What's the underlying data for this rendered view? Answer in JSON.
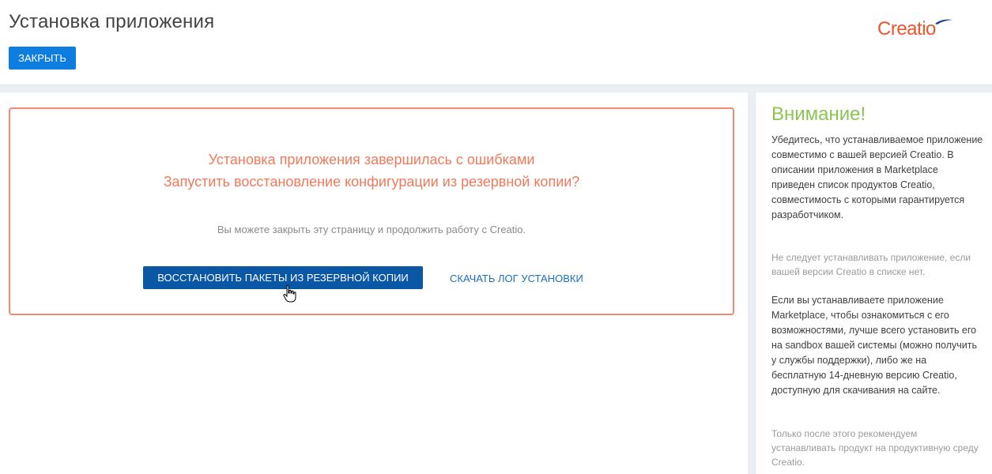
{
  "header": {
    "title": "Установка приложения",
    "close_label": "ЗАКРЫТЬ",
    "logo_text": "Creatio"
  },
  "main": {
    "error_line_1": "Установка приложения завершилась с ошибками",
    "error_line_2": "Запустить восстановление конфигурации из резервной копии?",
    "info_text": "Вы можете закрыть эту страницу и продолжить работу с Creatio.",
    "restore_button_label": "ВОССТАНОВИТЬ ПАКЕТЫ ИЗ РЕЗЕРВНОЙ КОПИИ",
    "download_log_label": "СКАЧАТЬ ЛОГ УСТАНОВКИ"
  },
  "sidebar": {
    "title": "Внимание!",
    "paragraph_1": "Убедитесь, что устанавливаемое приложение совместимо с вашей версией Creatio. В описании приложения в Marketplace приведен список продуктов Creatio, совместимость с которыми гарантируется разработчиком.",
    "paragraph_2": "Не следует устанавливать приложение, если вашей версии Creatio в списке нет.",
    "paragraph_3": "Если вы устанавливаете приложение Marketplace, чтобы ознакомиться с его возможностями, лучше всего установить его на sandbox вашей системы (можно получить у службы поддержки), либо же на бесплатную 14-дневную версию Creatio, доступную для скачивания на сайте.",
    "paragraph_4": "Только после этого рекомендуем устанавливать продукт на продуктивную среду Creatio."
  },
  "icons": {
    "cursor": "hand-pointer-icon",
    "logo_mark": "creatio-logo-mark"
  },
  "colors": {
    "primary_button": "#0d7ee0",
    "restore_button": "#0a57a6",
    "error_text": "#f07a5c",
    "error_border": "#f08a72",
    "attention_title": "#8cc453",
    "link": "#1b6ec2",
    "logo": "#f0552a"
  }
}
